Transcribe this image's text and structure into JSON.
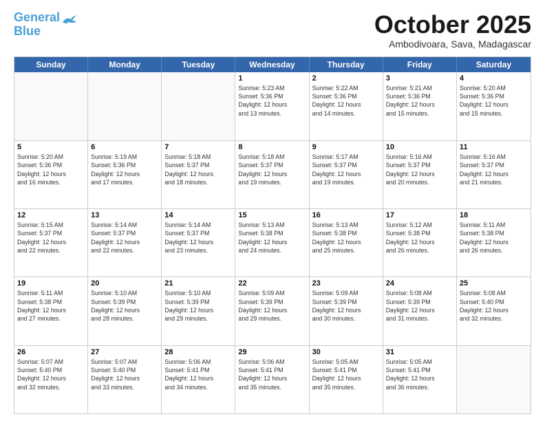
{
  "header": {
    "logo_line1": "General",
    "logo_line2": "Blue",
    "month": "October 2025",
    "location": "Ambodivoara, Sava, Madagascar"
  },
  "weekdays": [
    "Sunday",
    "Monday",
    "Tuesday",
    "Wednesday",
    "Thursday",
    "Friday",
    "Saturday"
  ],
  "rows": [
    [
      {
        "day": "",
        "info": ""
      },
      {
        "day": "",
        "info": ""
      },
      {
        "day": "",
        "info": ""
      },
      {
        "day": "1",
        "info": "Sunrise: 5:23 AM\nSunset: 5:36 PM\nDaylight: 12 hours\nand 13 minutes."
      },
      {
        "day": "2",
        "info": "Sunrise: 5:22 AM\nSunset: 5:36 PM\nDaylight: 12 hours\nand 14 minutes."
      },
      {
        "day": "3",
        "info": "Sunrise: 5:21 AM\nSunset: 5:36 PM\nDaylight: 12 hours\nand 15 minutes."
      },
      {
        "day": "4",
        "info": "Sunrise: 5:20 AM\nSunset: 5:36 PM\nDaylight: 12 hours\nand 15 minutes."
      }
    ],
    [
      {
        "day": "5",
        "info": "Sunrise: 5:20 AM\nSunset: 5:36 PM\nDaylight: 12 hours\nand 16 minutes."
      },
      {
        "day": "6",
        "info": "Sunrise: 5:19 AM\nSunset: 5:36 PM\nDaylight: 12 hours\nand 17 minutes."
      },
      {
        "day": "7",
        "info": "Sunrise: 5:18 AM\nSunset: 5:37 PM\nDaylight: 12 hours\nand 18 minutes."
      },
      {
        "day": "8",
        "info": "Sunrise: 5:18 AM\nSunset: 5:37 PM\nDaylight: 12 hours\nand 19 minutes."
      },
      {
        "day": "9",
        "info": "Sunrise: 5:17 AM\nSunset: 5:37 PM\nDaylight: 12 hours\nand 19 minutes."
      },
      {
        "day": "10",
        "info": "Sunrise: 5:16 AM\nSunset: 5:37 PM\nDaylight: 12 hours\nand 20 minutes."
      },
      {
        "day": "11",
        "info": "Sunrise: 5:16 AM\nSunset: 5:37 PM\nDaylight: 12 hours\nand 21 minutes."
      }
    ],
    [
      {
        "day": "12",
        "info": "Sunrise: 5:15 AM\nSunset: 5:37 PM\nDaylight: 12 hours\nand 22 minutes."
      },
      {
        "day": "13",
        "info": "Sunrise: 5:14 AM\nSunset: 5:37 PM\nDaylight: 12 hours\nand 22 minutes."
      },
      {
        "day": "14",
        "info": "Sunrise: 5:14 AM\nSunset: 5:37 PM\nDaylight: 12 hours\nand 23 minutes."
      },
      {
        "day": "15",
        "info": "Sunrise: 5:13 AM\nSunset: 5:38 PM\nDaylight: 12 hours\nand 24 minutes."
      },
      {
        "day": "16",
        "info": "Sunrise: 5:13 AM\nSunset: 5:38 PM\nDaylight: 12 hours\nand 25 minutes."
      },
      {
        "day": "17",
        "info": "Sunrise: 5:12 AM\nSunset: 5:38 PM\nDaylight: 12 hours\nand 26 minutes."
      },
      {
        "day": "18",
        "info": "Sunrise: 5:11 AM\nSunset: 5:38 PM\nDaylight: 12 hours\nand 26 minutes."
      }
    ],
    [
      {
        "day": "19",
        "info": "Sunrise: 5:11 AM\nSunset: 5:38 PM\nDaylight: 12 hours\nand 27 minutes."
      },
      {
        "day": "20",
        "info": "Sunrise: 5:10 AM\nSunset: 5:39 PM\nDaylight: 12 hours\nand 28 minutes."
      },
      {
        "day": "21",
        "info": "Sunrise: 5:10 AM\nSunset: 5:39 PM\nDaylight: 12 hours\nand 29 minutes."
      },
      {
        "day": "22",
        "info": "Sunrise: 5:09 AM\nSunset: 5:39 PM\nDaylight: 12 hours\nand 29 minutes."
      },
      {
        "day": "23",
        "info": "Sunrise: 5:09 AM\nSunset: 5:39 PM\nDaylight: 12 hours\nand 30 minutes."
      },
      {
        "day": "24",
        "info": "Sunrise: 5:08 AM\nSunset: 5:39 PM\nDaylight: 12 hours\nand 31 minutes."
      },
      {
        "day": "25",
        "info": "Sunrise: 5:08 AM\nSunset: 5:40 PM\nDaylight: 12 hours\nand 32 minutes."
      }
    ],
    [
      {
        "day": "26",
        "info": "Sunrise: 5:07 AM\nSunset: 5:40 PM\nDaylight: 12 hours\nand 32 minutes."
      },
      {
        "day": "27",
        "info": "Sunrise: 5:07 AM\nSunset: 5:40 PM\nDaylight: 12 hours\nand 33 minutes."
      },
      {
        "day": "28",
        "info": "Sunrise: 5:06 AM\nSunset: 5:41 PM\nDaylight: 12 hours\nand 34 minutes."
      },
      {
        "day": "29",
        "info": "Sunrise: 5:06 AM\nSunset: 5:41 PM\nDaylight: 12 hours\nand 35 minutes."
      },
      {
        "day": "30",
        "info": "Sunrise: 5:05 AM\nSunset: 5:41 PM\nDaylight: 12 hours\nand 35 minutes."
      },
      {
        "day": "31",
        "info": "Sunrise: 5:05 AM\nSunset: 5:41 PM\nDaylight: 12 hours\nand 36 minutes."
      },
      {
        "day": "",
        "info": ""
      }
    ]
  ]
}
